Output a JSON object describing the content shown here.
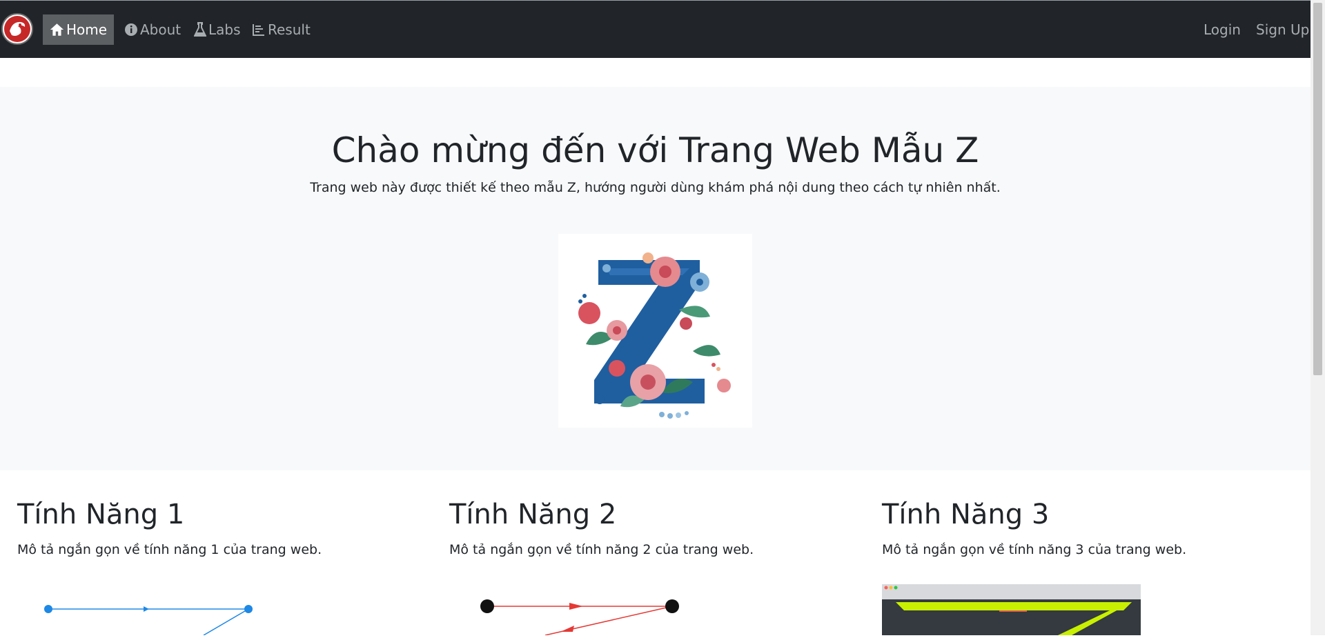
{
  "nav": {
    "items": [
      {
        "label": "Home",
        "icon": "home-icon",
        "active": true
      },
      {
        "label": "About",
        "icon": "info-icon"
      },
      {
        "label": "Labs",
        "icon": "flask-icon"
      },
      {
        "label": "Result",
        "icon": "list-icon"
      }
    ],
    "login_label": "Login",
    "signup_label": "Sign Up"
  },
  "hero": {
    "title": "Chào mừng đến với Trang Web Mẫu Z",
    "subtitle": "Trang web này được thiết kế theo mẫu Z, hướng người dùng khám phá nội dung theo cách tự nhiên nhất."
  },
  "features": [
    {
      "title": "Tính Năng 1",
      "description": "Mô tả ngắn gọn về tính năng 1 của trang web."
    },
    {
      "title": "Tính Năng 2",
      "description": "Mô tả ngắn gọn về tính năng 2 của trang web."
    },
    {
      "title": "Tính Năng 3",
      "description": "Mô tả ngắn gọn về tính năng 3 của trang web."
    }
  ],
  "colors": {
    "navbar": "#212529",
    "hero_bg": "#f8f9fa",
    "accent_lime": "#c8f000"
  }
}
